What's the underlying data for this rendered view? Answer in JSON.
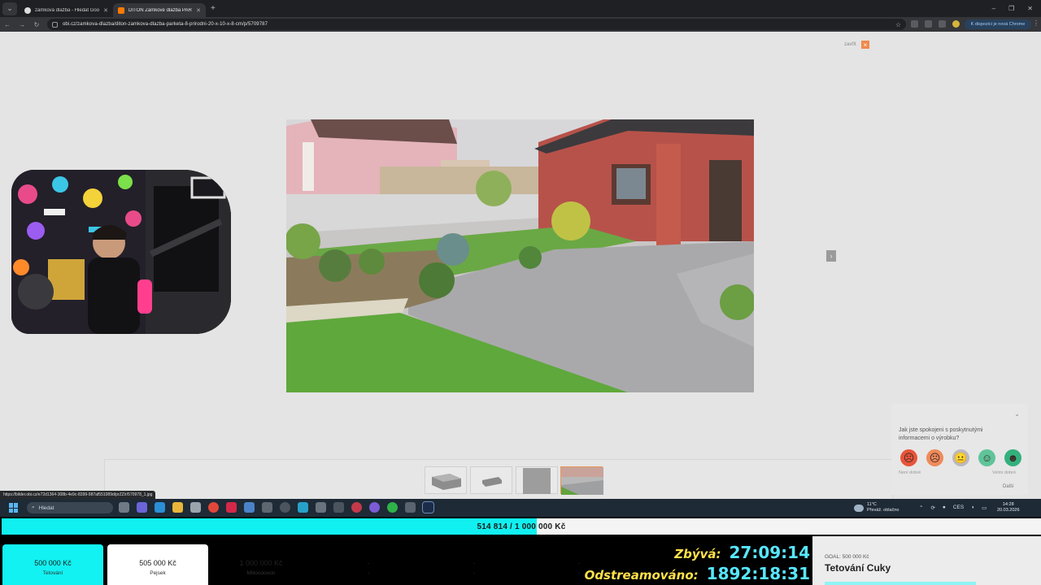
{
  "browser": {
    "tabs": [
      {
        "title": "zámková dlažba - Hledat Googl",
        "active": false
      },
      {
        "title": "DITON Zámkové dlažba PARKE",
        "active": true
      }
    ],
    "url": "obi.cz/zamkova-dlazba/diton-zamkova-dlazba-parketa-8-prirodni-20-x-10-x-8-cm/p/5709787",
    "update_label": "K dispozici je nová Chrome",
    "status_url": "https://bilder.obi.cz/e72d1364-308b-4e9c-8399-987af551089d/prZZ/r/570978_1.jpg"
  },
  "viewer": {
    "close_label": "zavřít",
    "close_icon": "×",
    "next_icon": "›"
  },
  "feedback": {
    "question": "Jak jste spokojeni s poskytnutými informacemi o výrobku?",
    "low_label": "Není dobré",
    "high_label": "Velmi dobré",
    "next_label": "Další",
    "faces": [
      {
        "name": "very-unhappy-face-icon",
        "color": "#e8543a",
        "glyph": "☹"
      },
      {
        "name": "unhappy-face-icon",
        "color": "#ef8a5a",
        "glyph": "☹"
      },
      {
        "name": "neutral-face-icon",
        "color": "#b9b9bf",
        "glyph": "😐"
      },
      {
        "name": "happy-face-icon",
        "color": "#5fc49a",
        "glyph": "☺"
      },
      {
        "name": "very-happy-face-icon",
        "color": "#33b07d",
        "glyph": "☻"
      }
    ]
  },
  "taskbar": {
    "search_placeholder": "Hledat",
    "weather_temp": "11°C",
    "weather_desc": "Převáž. oblačno",
    "language": "CES",
    "time": "14:28",
    "date": "20.03.2026"
  },
  "overlay": {
    "goal_progress": "514 814 / 1 000 000 Kč",
    "goal_fraction": 0.5148,
    "cards": [
      {
        "amount": "500 000 Kč",
        "label": "Tetování",
        "style": "cyan"
      },
      {
        "amount": "505 000 Kč",
        "label": "Pejsek",
        "style": "cyan"
      },
      {
        "amount": "1 000 000 Kč",
        "label": "Milioooooon",
        "style": "grey"
      },
      {
        "amount": "-",
        "label": "-",
        "style": "white"
      },
      {
        "amount": "-",
        "label": "-",
        "style": "white"
      },
      {
        "amount": "-",
        "label": "-",
        "style": "white"
      }
    ],
    "remaining_label": "Zbývá:",
    "remaining_value": "27:09:14",
    "streamed_label": "Odstreamováno:",
    "streamed_value": "1892:18:31",
    "goal_title_label": "GOAL: 500 000 Kč",
    "goal_title": "Tetování Cuky"
  },
  "colors": {
    "accent_cyan": "#12f2f2",
    "obi_orange": "#ff7a00",
    "timer_yellow": "#ffe04a",
    "timer_cyan": "#57e7ff"
  }
}
